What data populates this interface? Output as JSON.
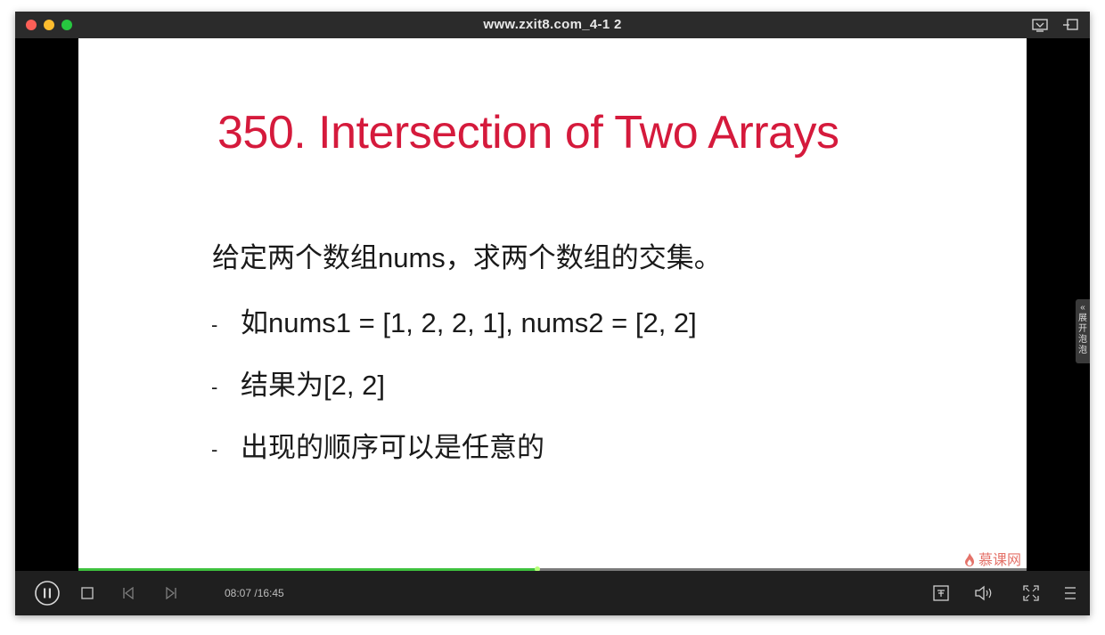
{
  "window": {
    "title": "www.zxit8.com_4-1 2"
  },
  "slide": {
    "title": "350. Intersection of Two Arrays",
    "intro": "给定两个数组nums，求两个数组的交集。",
    "bullets": [
      "如nums1 = [1, 2, 2, 1], nums2 = [2, 2]",
      "结果为[2, 2]",
      "出现的顺序可以是任意的"
    ],
    "bullet_marker": "-",
    "watermark": "慕课网"
  },
  "side_tab": {
    "arrow": "«",
    "label_chars": [
      "展",
      "开",
      "泡",
      "泡"
    ]
  },
  "player": {
    "current_time": "08:07",
    "total_time": "16:45",
    "time_text": "08:07 /16:45",
    "progress_fraction": 0.484
  },
  "colors": {
    "title_red": "#d51a3c",
    "progress_green": "#3ec13e"
  }
}
